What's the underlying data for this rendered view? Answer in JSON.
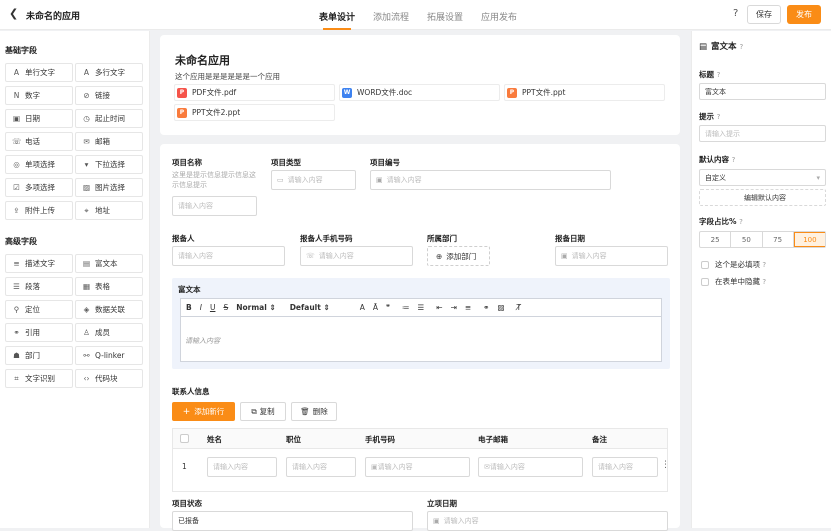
{
  "header": {
    "back_icon": "chevron-left-icon",
    "app_title": "未命名的应用",
    "tabs": [
      "表单设计",
      "添加流程",
      "拓展设置",
      "应用发布"
    ],
    "active_tab": 0,
    "help_label": "?",
    "save_label": "保存",
    "publish_label": "发布",
    "accent_color": "#fa8c16"
  },
  "sidebar": {
    "basic_title": "基础字段",
    "basic_fields": [
      {
        "icon": "A",
        "label": "单行文字"
      },
      {
        "icon": "A",
        "label": "多行文字"
      },
      {
        "icon": "N",
        "label": "数字"
      },
      {
        "icon": "⊘",
        "label": "链接"
      },
      {
        "icon": "▣",
        "label": "日期"
      },
      {
        "icon": "◷",
        "label": "起止时间"
      },
      {
        "icon": "☏",
        "label": "电话"
      },
      {
        "icon": "✉",
        "label": "邮箱"
      },
      {
        "icon": "◎",
        "label": "单项选择"
      },
      {
        "icon": "▾",
        "label": "下拉选择"
      },
      {
        "icon": "☑",
        "label": "多项选择"
      },
      {
        "icon": "▨",
        "label": "图片选择"
      },
      {
        "icon": "⇪",
        "label": "附件上传"
      },
      {
        "icon": "⌖",
        "label": "地址"
      }
    ],
    "advanced_title": "高级字段",
    "advanced_fields": [
      {
        "icon": "≡",
        "label": "描述文字"
      },
      {
        "icon": "▤",
        "label": "富文本"
      },
      {
        "icon": "☰",
        "label": "段落"
      },
      {
        "icon": "▦",
        "label": "表格"
      },
      {
        "icon": "⚲",
        "label": "定位"
      },
      {
        "icon": "◈",
        "label": "数据关联"
      },
      {
        "icon": "⚭",
        "label": "引用"
      },
      {
        "icon": "♙",
        "label": "成员"
      },
      {
        "icon": "☗",
        "label": "部门"
      },
      {
        "icon": "⚯",
        "label": "Q-linker"
      },
      {
        "icon": "⌗",
        "label": "文字识别"
      },
      {
        "icon": "‹›",
        "label": "代码块"
      }
    ]
  },
  "form": {
    "name": "未命名应用",
    "description": "这个应用是是是是是是一个应用",
    "files": [
      {
        "name": "PDF文件.pdf",
        "type": "P",
        "color": "#f5544a"
      },
      {
        "name": "WORD文件.doc",
        "type": "W",
        "color": "#3d82f0"
      },
      {
        "name": "PPT文件.ppt",
        "type": "P",
        "color": "#f97b3d"
      },
      {
        "name": "PPT文件2.ppt",
        "type": "P",
        "color": "#f97b3d"
      }
    ],
    "project_name_label": "项目名称",
    "project_name_hint": "这里是提示信息提示信息这示信息提示",
    "project_type_label": "项目类型",
    "project_no_label": "项目编号",
    "placeholder": "请输入内容",
    "reporter_label": "报备人",
    "reporter_phone_label": "报备人手机号码",
    "dept_label": "所属部门",
    "add_dept_label": "添加部门",
    "report_date_label": "报备日期",
    "richtext_label": "富文本",
    "toolbar_items": [
      "B",
      "I",
      "U",
      "S",
      "Normal ⇕",
      "Default ⇕",
      "A",
      "Ā",
      "❞",
      "≔",
      "☰",
      "⇤",
      "⇥",
      "≡",
      "⚭",
      "▨",
      "T̸"
    ],
    "editor_placeholder": "请输入内容",
    "contacts_label": "联系人信息",
    "add_row_label": "添加新行",
    "copy_label": "复制",
    "delete_label": "删除",
    "table_headers": [
      "姓名",
      "职位",
      "手机号码",
      "电子邮箱",
      "备注"
    ],
    "row_index": "1",
    "status_label": "项目状态",
    "status_value": "已报备",
    "setup_date_label": "立项日期"
  },
  "props": {
    "panel_title": "富文本",
    "title_label": "标题",
    "title_value": "富文本",
    "hint_label": "提示",
    "hint_placeholder": "请输入提示",
    "default_label": "默认内容",
    "default_value": "自定义",
    "edit_default_label": "编辑默认内容",
    "ratio_label": "字段占比%",
    "ratio_options": [
      "25",
      "50",
      "75",
      "100"
    ],
    "ratio_selected": "100",
    "required_label": "这个是必填项",
    "hidden_label": "在表单中隐藏",
    "q_mark": "?"
  }
}
